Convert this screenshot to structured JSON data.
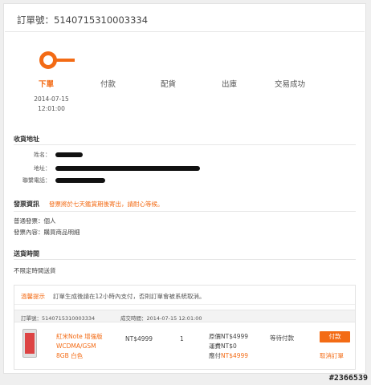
{
  "order": {
    "title_prefix": "訂單號：",
    "number": "5140715310003334"
  },
  "progress": {
    "steps": [
      "下單",
      "付款",
      "配貨",
      "出庫",
      "交易成功"
    ],
    "active_index": 0,
    "date": "2014-07-15",
    "time": "12:01:00"
  },
  "address": {
    "title": "收貨地址",
    "name_label": "姓名：",
    "addr_label": "地址：",
    "phone_label": "聯繫電話："
  },
  "invoice": {
    "title": "發票資訊",
    "note": "發票將於七天鑑賞期後寄出，請耐心等候。",
    "type_line": "普通發票：個人",
    "content_line": "發票內容：購買商品明細"
  },
  "delivery": {
    "title": "送貨時間",
    "value": "不限定時間送貨"
  },
  "order_box": {
    "tip_title": "溫馨提示",
    "tip_text": "訂單生成後請在12小時內支付，否則訂單會被系統取消。",
    "header_order": "訂單號：5140715310003334",
    "header_time": "成交時間：2014-07-15 12:01:00",
    "product_line1": "紅米Note 增強版",
    "product_line2": "WCDMA/GSM",
    "product_line3": "8GB 白色",
    "price": "NT$4999",
    "qty": "1",
    "orig_price": "原價NT$4999",
    "shipping": "運費NT$0",
    "due_label": "應付",
    "due_value": "NT$4999",
    "status": "等待付款",
    "pay_button": "付款",
    "cancel_link": "取消訂單"
  },
  "watermark": "#2366539"
}
